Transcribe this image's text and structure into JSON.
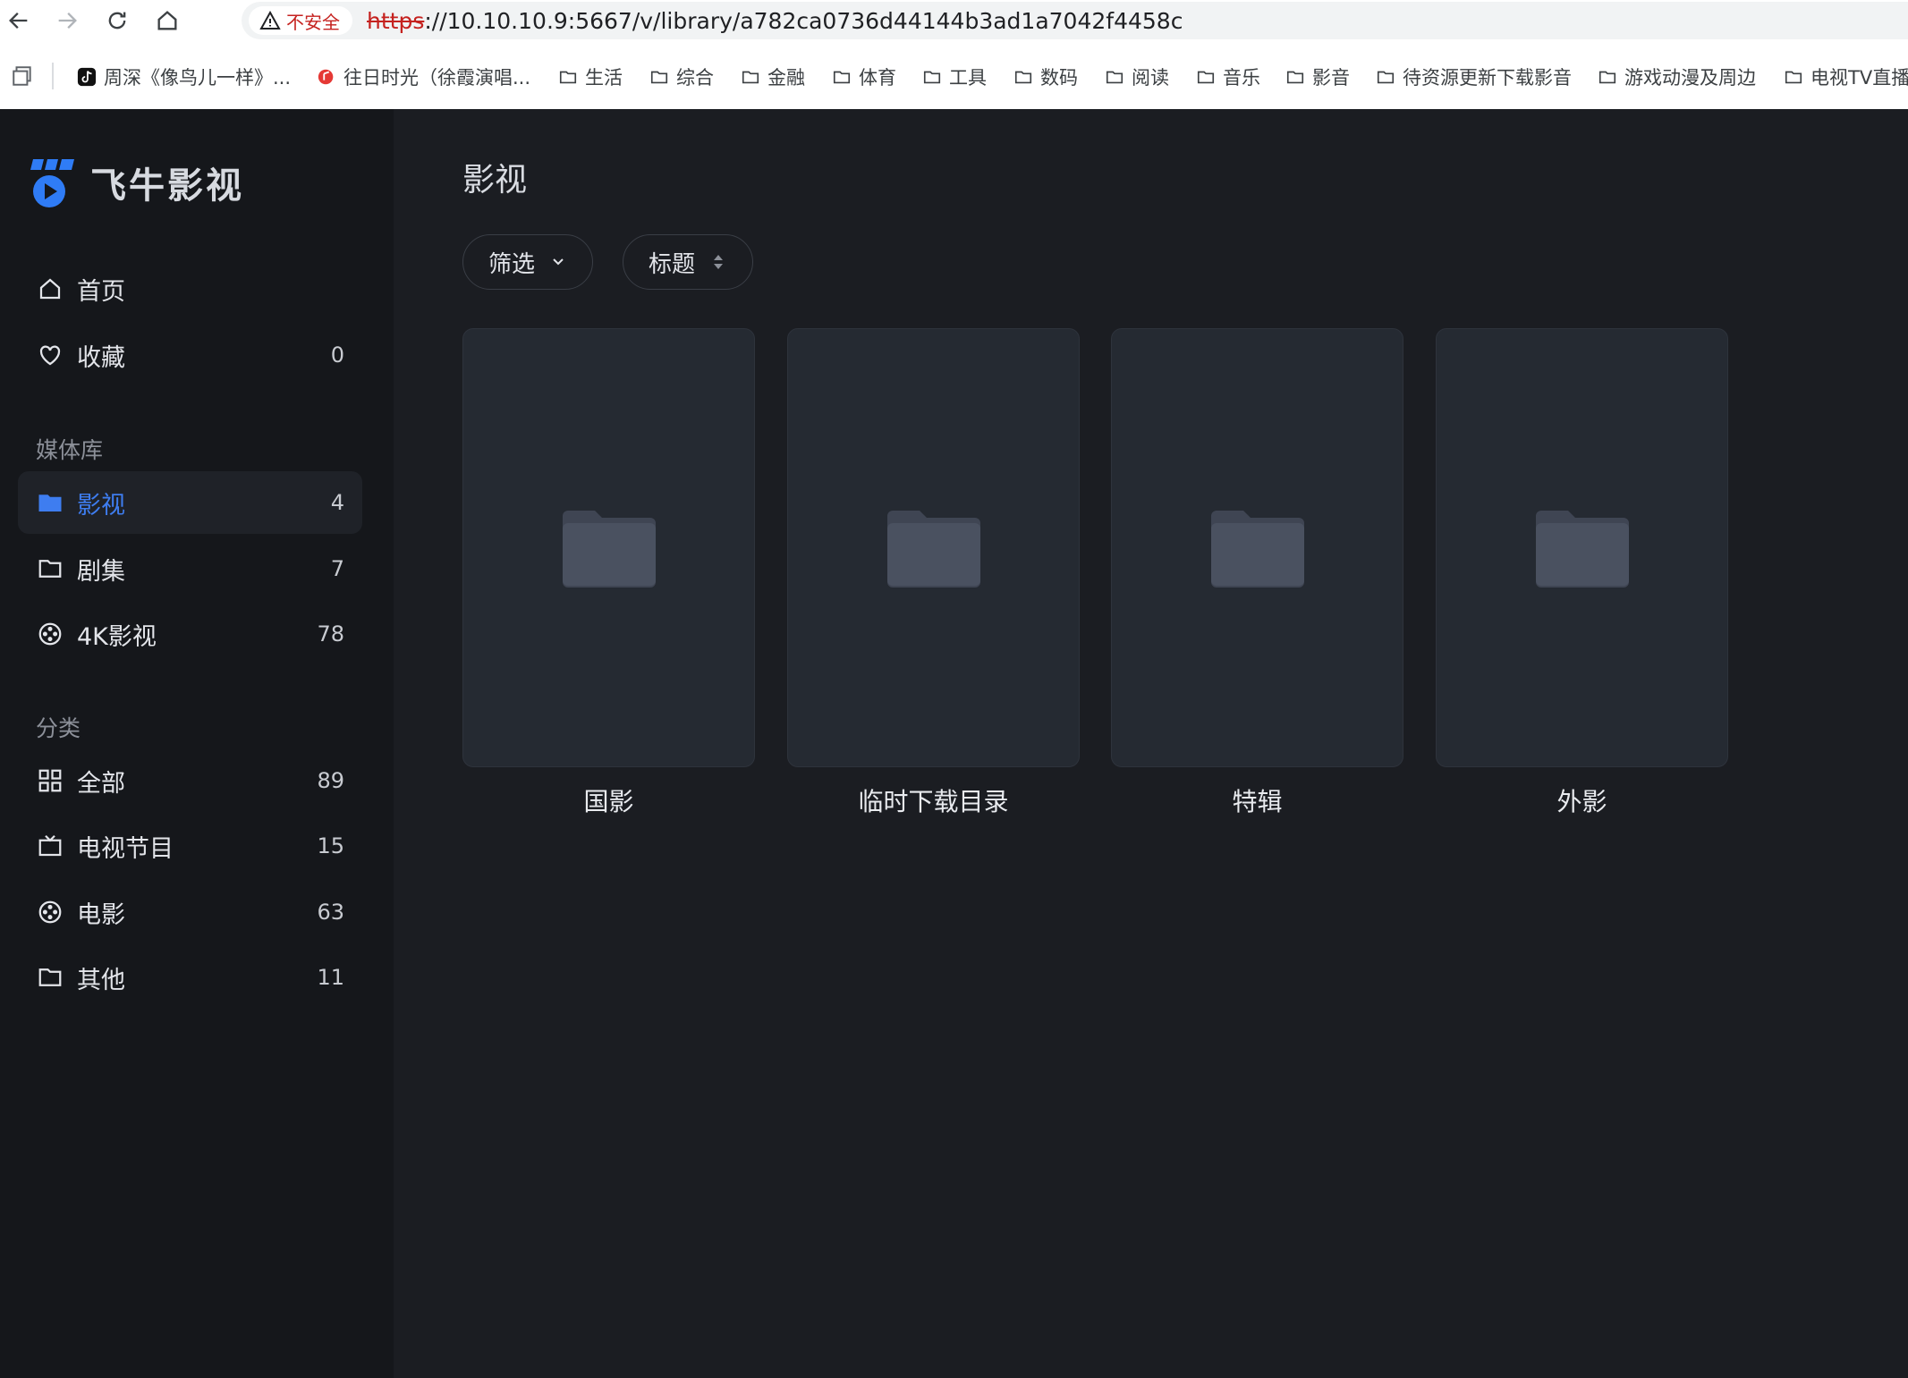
{
  "browser": {
    "security_label": "不安全",
    "url_scheme": "https",
    "url_rest": "://10.10.10.9:5667/v/library/a782ca0736d44144b3ad1a7042f4458c",
    "bookmarks": [
      {
        "label": "周深《像鸟儿一样》...",
        "icon": "tiktok-icon"
      },
      {
        "label": "往日时光（徐霞演唱...",
        "icon": "music-app-icon"
      },
      {
        "label": "生活",
        "icon": "folder-icon"
      },
      {
        "label": "综合",
        "icon": "folder-icon"
      },
      {
        "label": "金融",
        "icon": "folder-icon"
      },
      {
        "label": "体育",
        "icon": "folder-icon"
      },
      {
        "label": "工具",
        "icon": "folder-icon"
      },
      {
        "label": "数码",
        "icon": "folder-icon"
      },
      {
        "label": "阅读",
        "icon": "folder-icon"
      },
      {
        "label": "音乐",
        "icon": "folder-icon"
      },
      {
        "label": "影音",
        "icon": "folder-icon"
      },
      {
        "label": "待资源更新下载影音",
        "icon": "folder-icon"
      },
      {
        "label": "游戏动漫及周边",
        "icon": "folder-icon"
      },
      {
        "label": "电视TV直播",
        "icon": "folder-icon"
      }
    ]
  },
  "app": {
    "name": "飞牛影视",
    "accent": "#3e7df0"
  },
  "sidebar": {
    "top_items": [
      {
        "label": "首页",
        "count": "",
        "icon": "home-icon"
      },
      {
        "label": "收藏",
        "count": "0",
        "icon": "heart-icon"
      }
    ],
    "library_section": "媒体库",
    "library_items": [
      {
        "label": "影视",
        "count": "4",
        "icon": "folder-icon",
        "active": true
      },
      {
        "label": "剧集",
        "count": "7",
        "icon": "folder-icon"
      },
      {
        "label": "4K影视",
        "count": "78",
        "icon": "film-reel-icon"
      }
    ],
    "category_section": "分类",
    "category_items": [
      {
        "label": "全部",
        "count": "89",
        "icon": "grid-icon"
      },
      {
        "label": "电视节目",
        "count": "15",
        "icon": "tv-icon"
      },
      {
        "label": "电影",
        "count": "63",
        "icon": "film-reel-icon"
      },
      {
        "label": "其他",
        "count": "11",
        "icon": "folder-icon"
      }
    ]
  },
  "main": {
    "title": "影视",
    "filter_label": "筛选",
    "sort_label": "标题",
    "folders": [
      {
        "name": "国影"
      },
      {
        "name": "临时下载目录"
      },
      {
        "name": "特辑"
      },
      {
        "name": "外影"
      }
    ]
  }
}
